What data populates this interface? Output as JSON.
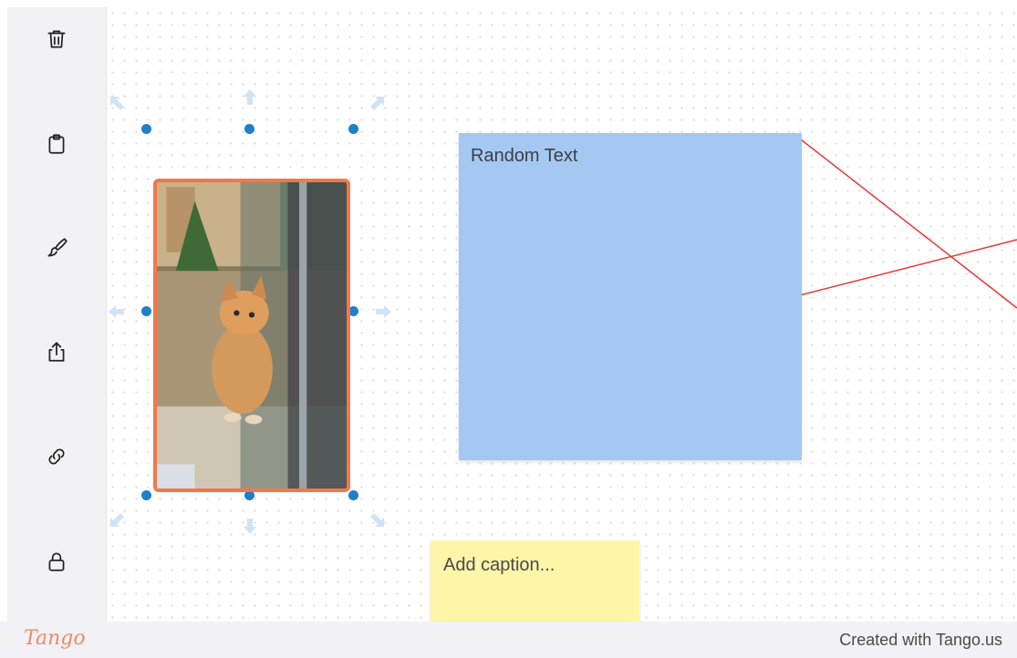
{
  "sidebar": {
    "tools": [
      {
        "name": "delete",
        "icon": "trash-icon"
      },
      {
        "name": "paste",
        "icon": "clipboard-icon"
      },
      {
        "name": "style",
        "icon": "paintbrush-icon"
      },
      {
        "name": "share",
        "icon": "share-icon"
      },
      {
        "name": "link",
        "icon": "link-icon"
      },
      {
        "name": "lock",
        "icon": "lock-icon"
      }
    ]
  },
  "canvas": {
    "blue_note": {
      "text": "Random Text",
      "color": "#a4c8f1"
    },
    "caption_note": {
      "placeholder": "Add caption...",
      "color": "#fdf5a8"
    },
    "selection_color": "#f2784b",
    "handle_color": "#1f7fc8",
    "connector_color": "#e53935"
  },
  "footer": {
    "brand": "Tango",
    "credit": "Created with Tango.us"
  }
}
